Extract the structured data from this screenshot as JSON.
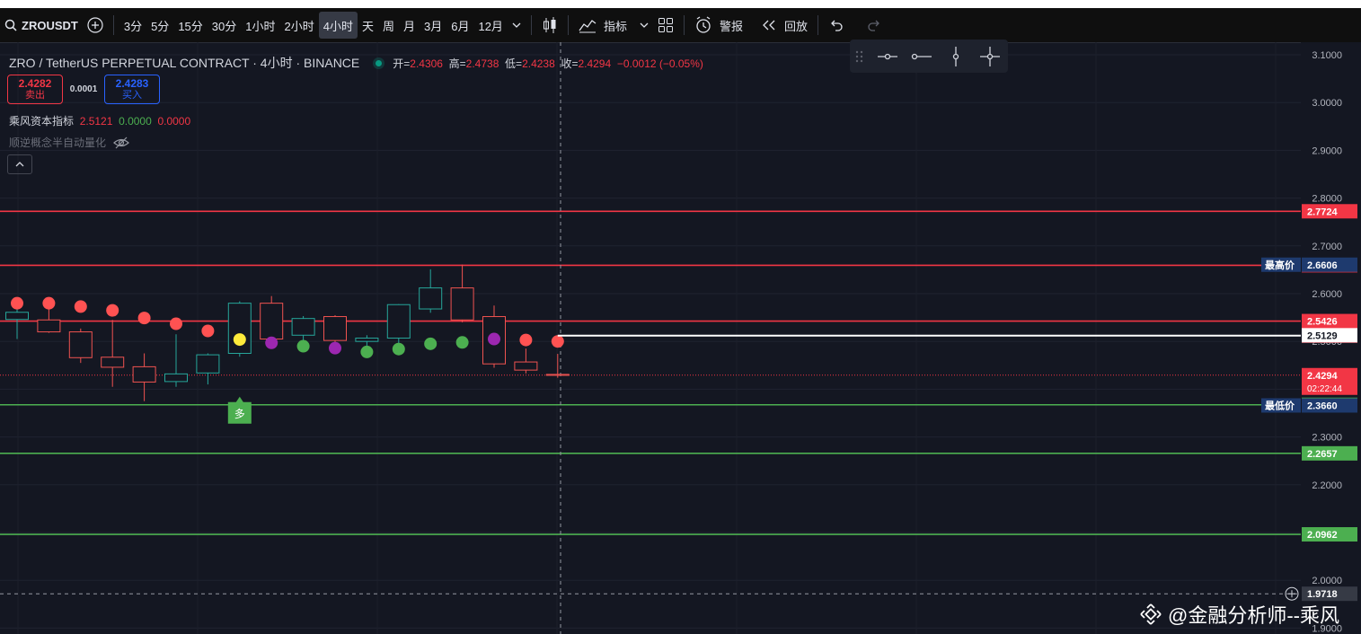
{
  "toolbar": {
    "symbol": "ZROUSDT",
    "timeframes": [
      "3分",
      "5分",
      "15分",
      "30分",
      "1小时",
      "2小时",
      "4小时",
      "天",
      "周",
      "月",
      "3月",
      "6月",
      "12月"
    ],
    "active_timeframe": "4小时",
    "indicators_label": "指标",
    "alert_label": "警报",
    "replay_label": "回放"
  },
  "legend": {
    "title": "ZRO / TetherUS PERPETUAL CONTRACT · 4小时 · BINANCE",
    "open_label": "开=",
    "open": "2.4306",
    "high_label": "高=",
    "high": "2.4738",
    "low_label": "低=",
    "low": "2.4238",
    "close_label": "收=",
    "close": "2.4294",
    "change": "−0.0012 (−0.05%)"
  },
  "bidask": {
    "sell_price": "2.4282",
    "sell_label": "卖出",
    "spread": "0.0001",
    "buy_price": "2.4283",
    "buy_label": "买入"
  },
  "indicator1": {
    "name": "乘风资本指标",
    "v1": "2.5121",
    "v2": "0.0000",
    "v3": "0.0000"
  },
  "indicator2": {
    "name": "顺逆概念半自动量化"
  },
  "signal_label": "多",
  "watermark": "@金融分析师--乘风",
  "colors": {
    "up": "#26a69a",
    "down": "#ef5350",
    "red_line": "#f23645",
    "green_line": "#4caf50",
    "bg": "#141722"
  },
  "chart_data": {
    "type": "candlestick",
    "y_axis": {
      "min": 1.9,
      "max": 3.1,
      "ticks": [
        "3.1000",
        "3.0000",
        "2.9000",
        "2.8000",
        "2.7000",
        "2.6000",
        "2.5000",
        "2.4000",
        "2.3000",
        "2.2000",
        "2.1000",
        "2.0000",
        "1.9000"
      ]
    },
    "candles": [
      {
        "o": 2.546,
        "h": 2.58,
        "l": 2.505,
        "c": 2.561
      },
      {
        "o": 2.545,
        "h": 2.572,
        "l": 2.518,
        "c": 2.52
      },
      {
        "o": 2.52,
        "h": 2.527,
        "l": 2.455,
        "c": 2.466
      },
      {
        "o": 2.467,
        "h": 2.545,
        "l": 2.405,
        "c": 2.446
      },
      {
        "o": 2.447,
        "h": 2.475,
        "l": 2.375,
        "c": 2.415
      },
      {
        "o": 2.416,
        "h": 2.515,
        "l": 2.405,
        "c": 2.432
      },
      {
        "o": 2.434,
        "h": 2.475,
        "l": 2.41,
        "c": 2.472
      },
      {
        "o": 2.475,
        "h": 2.584,
        "l": 2.468,
        "c": 2.58
      },
      {
        "o": 2.58,
        "h": 2.595,
        "l": 2.5,
        "c": 2.505
      },
      {
        "o": 2.513,
        "h": 2.553,
        "l": 2.488,
        "c": 2.548
      },
      {
        "o": 2.552,
        "h": 2.555,
        "l": 2.492,
        "c": 2.502
      },
      {
        "o": 2.5,
        "h": 2.513,
        "l": 2.47,
        "c": 2.507
      },
      {
        "o": 2.507,
        "h": 2.578,
        "l": 2.49,
        "c": 2.577
      },
      {
        "o": 2.568,
        "h": 2.651,
        "l": 2.56,
        "c": 2.612
      },
      {
        "o": 2.612,
        "h": 2.661,
        "l": 2.54,
        "c": 2.545
      },
      {
        "o": 2.552,
        "h": 2.575,
        "l": 2.445,
        "c": 2.453
      },
      {
        "o": 2.457,
        "h": 2.485,
        "l": 2.433,
        "c": 2.44
      },
      {
        "o": 2.431,
        "h": 2.474,
        "l": 2.424,
        "c": 2.429
      }
    ],
    "dots": [
      "red",
      "red",
      "red",
      "red",
      "red",
      "red",
      "red",
      "yellow",
      "purple",
      "green",
      "purple",
      "green",
      "green",
      "green",
      "green",
      "purple",
      "red",
      "red"
    ],
    "dot_values": [
      2.58,
      2.58,
      2.573,
      2.565,
      2.549,
      2.537,
      2.522,
      2.504,
      2.497,
      2.49,
      2.486,
      2.478,
      2.484,
      2.495,
      2.498,
      2.505,
      2.503,
      2.5
    ],
    "signal_marker": {
      "index": 7,
      "label": "多"
    },
    "lines": [
      {
        "value": 2.7724,
        "label": "2.7724",
        "color": "red"
      },
      {
        "value": 2.6594,
        "label": "2.6594",
        "color": "red"
      },
      {
        "value": 2.5426,
        "label": "2.5426",
        "color": "red"
      },
      {
        "value": 2.3674,
        "label": "2.3674",
        "color": "green"
      },
      {
        "value": 2.2657,
        "label": "2.2657",
        "color": "green"
      },
      {
        "value": 2.0962,
        "label": "2.0962",
        "color": "green"
      }
    ],
    "ray": {
      "value": 2.5121,
      "label": "2.5121"
    },
    "price_labels": [
      {
        "value": 2.6606,
        "text": "2.6606",
        "tag": "最高价"
      },
      {
        "value": 2.5129,
        "text": "2.5129"
      },
      {
        "value": 2.4294,
        "text": "2.4294",
        "sub": "02:22:44"
      },
      {
        "value": 2.366,
        "text": "2.3660",
        "tag": "最低价"
      },
      {
        "value": 1.9718,
        "text": "1.9718"
      }
    ],
    "last_price": 2.4294
  }
}
